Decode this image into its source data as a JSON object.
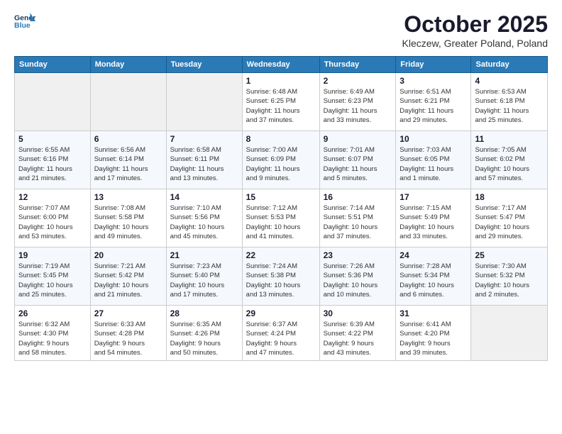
{
  "header": {
    "logo_line1": "General",
    "logo_line2": "Blue",
    "month": "October 2025",
    "location": "Kleczew, Greater Poland, Poland"
  },
  "days_of_week": [
    "Sunday",
    "Monday",
    "Tuesday",
    "Wednesday",
    "Thursday",
    "Friday",
    "Saturday"
  ],
  "weeks": [
    [
      {
        "day": "",
        "info": ""
      },
      {
        "day": "",
        "info": ""
      },
      {
        "day": "",
        "info": ""
      },
      {
        "day": "1",
        "info": "Sunrise: 6:48 AM\nSunset: 6:25 PM\nDaylight: 11 hours\nand 37 minutes."
      },
      {
        "day": "2",
        "info": "Sunrise: 6:49 AM\nSunset: 6:23 PM\nDaylight: 11 hours\nand 33 minutes."
      },
      {
        "day": "3",
        "info": "Sunrise: 6:51 AM\nSunset: 6:21 PM\nDaylight: 11 hours\nand 29 minutes."
      },
      {
        "day": "4",
        "info": "Sunrise: 6:53 AM\nSunset: 6:18 PM\nDaylight: 11 hours\nand 25 minutes."
      }
    ],
    [
      {
        "day": "5",
        "info": "Sunrise: 6:55 AM\nSunset: 6:16 PM\nDaylight: 11 hours\nand 21 minutes."
      },
      {
        "day": "6",
        "info": "Sunrise: 6:56 AM\nSunset: 6:14 PM\nDaylight: 11 hours\nand 17 minutes."
      },
      {
        "day": "7",
        "info": "Sunrise: 6:58 AM\nSunset: 6:11 PM\nDaylight: 11 hours\nand 13 minutes."
      },
      {
        "day": "8",
        "info": "Sunrise: 7:00 AM\nSunset: 6:09 PM\nDaylight: 11 hours\nand 9 minutes."
      },
      {
        "day": "9",
        "info": "Sunrise: 7:01 AM\nSunset: 6:07 PM\nDaylight: 11 hours\nand 5 minutes."
      },
      {
        "day": "10",
        "info": "Sunrise: 7:03 AM\nSunset: 6:05 PM\nDaylight: 11 hours\nand 1 minute."
      },
      {
        "day": "11",
        "info": "Sunrise: 7:05 AM\nSunset: 6:02 PM\nDaylight: 10 hours\nand 57 minutes."
      }
    ],
    [
      {
        "day": "12",
        "info": "Sunrise: 7:07 AM\nSunset: 6:00 PM\nDaylight: 10 hours\nand 53 minutes."
      },
      {
        "day": "13",
        "info": "Sunrise: 7:08 AM\nSunset: 5:58 PM\nDaylight: 10 hours\nand 49 minutes."
      },
      {
        "day": "14",
        "info": "Sunrise: 7:10 AM\nSunset: 5:56 PM\nDaylight: 10 hours\nand 45 minutes."
      },
      {
        "day": "15",
        "info": "Sunrise: 7:12 AM\nSunset: 5:53 PM\nDaylight: 10 hours\nand 41 minutes."
      },
      {
        "day": "16",
        "info": "Sunrise: 7:14 AM\nSunset: 5:51 PM\nDaylight: 10 hours\nand 37 minutes."
      },
      {
        "day": "17",
        "info": "Sunrise: 7:15 AM\nSunset: 5:49 PM\nDaylight: 10 hours\nand 33 minutes."
      },
      {
        "day": "18",
        "info": "Sunrise: 7:17 AM\nSunset: 5:47 PM\nDaylight: 10 hours\nand 29 minutes."
      }
    ],
    [
      {
        "day": "19",
        "info": "Sunrise: 7:19 AM\nSunset: 5:45 PM\nDaylight: 10 hours\nand 25 minutes."
      },
      {
        "day": "20",
        "info": "Sunrise: 7:21 AM\nSunset: 5:42 PM\nDaylight: 10 hours\nand 21 minutes."
      },
      {
        "day": "21",
        "info": "Sunrise: 7:23 AM\nSunset: 5:40 PM\nDaylight: 10 hours\nand 17 minutes."
      },
      {
        "day": "22",
        "info": "Sunrise: 7:24 AM\nSunset: 5:38 PM\nDaylight: 10 hours\nand 13 minutes."
      },
      {
        "day": "23",
        "info": "Sunrise: 7:26 AM\nSunset: 5:36 PM\nDaylight: 10 hours\nand 10 minutes."
      },
      {
        "day": "24",
        "info": "Sunrise: 7:28 AM\nSunset: 5:34 PM\nDaylight: 10 hours\nand 6 minutes."
      },
      {
        "day": "25",
        "info": "Sunrise: 7:30 AM\nSunset: 5:32 PM\nDaylight: 10 hours\nand 2 minutes."
      }
    ],
    [
      {
        "day": "26",
        "info": "Sunrise: 6:32 AM\nSunset: 4:30 PM\nDaylight: 9 hours\nand 58 minutes."
      },
      {
        "day": "27",
        "info": "Sunrise: 6:33 AM\nSunset: 4:28 PM\nDaylight: 9 hours\nand 54 minutes."
      },
      {
        "day": "28",
        "info": "Sunrise: 6:35 AM\nSunset: 4:26 PM\nDaylight: 9 hours\nand 50 minutes."
      },
      {
        "day": "29",
        "info": "Sunrise: 6:37 AM\nSunset: 4:24 PM\nDaylight: 9 hours\nand 47 minutes."
      },
      {
        "day": "30",
        "info": "Sunrise: 6:39 AM\nSunset: 4:22 PM\nDaylight: 9 hours\nand 43 minutes."
      },
      {
        "day": "31",
        "info": "Sunrise: 6:41 AM\nSunset: 4:20 PM\nDaylight: 9 hours\nand 39 minutes."
      },
      {
        "day": "",
        "info": ""
      }
    ]
  ]
}
